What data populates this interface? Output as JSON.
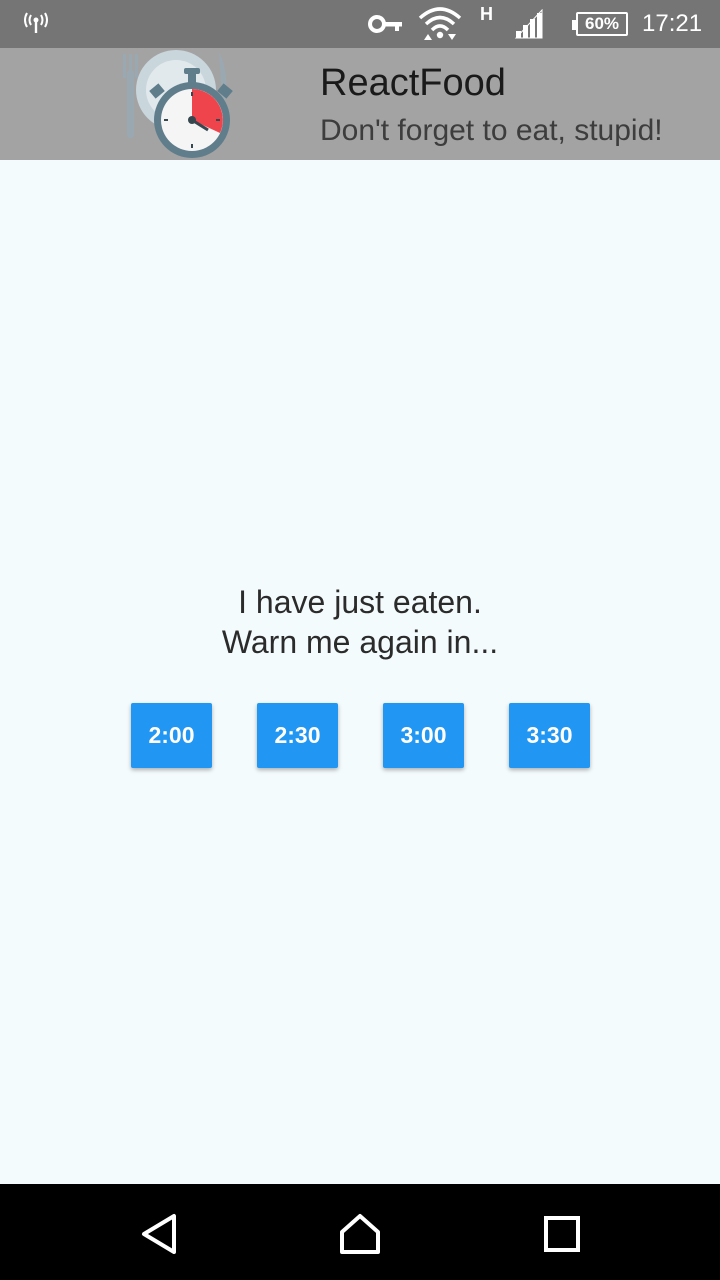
{
  "status_bar": {
    "battery": "60%",
    "network_type": "H",
    "time": "17:21",
    "icons": [
      "antenna-icon",
      "vpn-key-icon",
      "wifi-icon",
      "cell-signal-icon",
      "battery-icon"
    ]
  },
  "header": {
    "title": "ReactFood",
    "subtitle": "Don't forget to eat, stupid!",
    "logo_icon": "stopwatch-plate-logo"
  },
  "main": {
    "prompt_line1": "I have just eaten.",
    "prompt_line2": "Warn me again in...",
    "buttons": [
      {
        "label": "2:00"
      },
      {
        "label": "2:30"
      },
      {
        "label": "3:00"
      },
      {
        "label": "3:30"
      }
    ]
  },
  "nav_bar": {
    "icons": [
      "back-icon",
      "home-icon",
      "recents-icon"
    ]
  },
  "colors": {
    "status_bar": "#757575",
    "header": "#a3a3a3",
    "background": "#f4fbfd",
    "button": "#2196f3",
    "timer_red": "#f0444c"
  }
}
